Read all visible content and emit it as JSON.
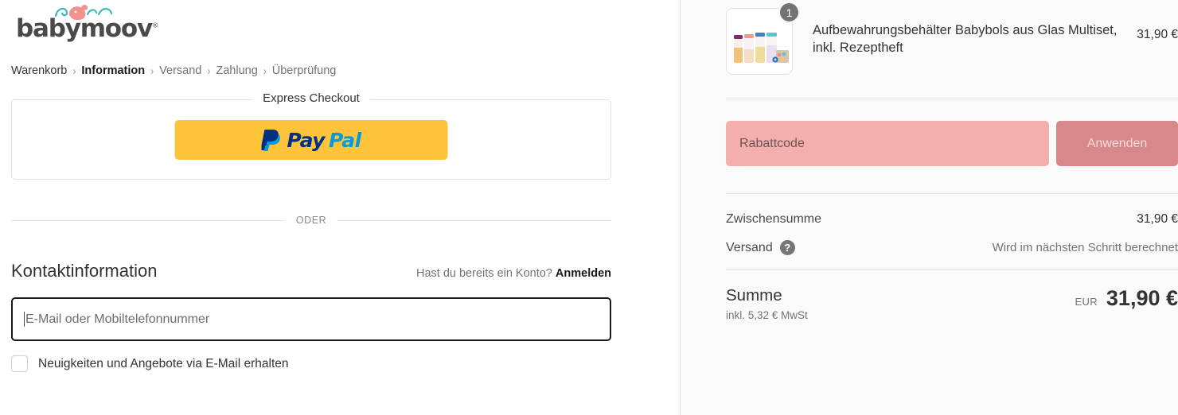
{
  "brand": {
    "logo_text": "babymoov",
    "registered_mark": "®",
    "logo_color": "#4a4a4a",
    "mascot_color": "#f0938f",
    "swirl_color": "#3fb8bd"
  },
  "breadcrumb": {
    "separator": "›",
    "items": [
      {
        "label": "Warenkorb",
        "state": "done"
      },
      {
        "label": "Information",
        "state": "active"
      },
      {
        "label": "Versand",
        "state": "upcoming"
      },
      {
        "label": "Zahlung",
        "state": "upcoming"
      },
      {
        "label": "Überprüfung",
        "state": "upcoming"
      }
    ]
  },
  "express": {
    "legend": "Express Checkout",
    "paypal": {
      "pay": "Pay",
      "pal": "Pal",
      "bg": "#ffc439",
      "pay_color": "#003087",
      "pal_color": "#009cde"
    }
  },
  "divider": {
    "text": "ODER"
  },
  "contact": {
    "title": "Kontaktinformation",
    "account_question": "Hast du bereits ein Konto?",
    "login_label": "Anmelden",
    "email_placeholder": "E-Mail oder Mobiltelefonnummer",
    "email_value": "",
    "newsletter_label": "Neuigkeiten und Angebote via E-Mail erhalten",
    "newsletter_checked": false
  },
  "summary": {
    "item": {
      "name": "Aufbewahrungsbehälter Babybols aus Glas Multiset, inkl. Rezeptheft",
      "quantity": "1",
      "price": "31,90 €"
    },
    "discount": {
      "placeholder": "Rabattcode",
      "value": "",
      "apply_label": "Anwenden",
      "field_bg": "#f4afac",
      "button_bg": "#d9888a"
    },
    "rows": [
      {
        "label": "Zwischensumme",
        "value": "31,90 €",
        "muted": false,
        "help": false
      },
      {
        "label": "Versand",
        "value": "Wird im nächsten Schritt berechnet",
        "muted": true,
        "help": true
      }
    ],
    "total": {
      "label": "Summe",
      "tax_note": "inkl. 5,32 € MwSt",
      "currency": "EUR",
      "value": "31,90 €"
    },
    "help_glyph": "?"
  }
}
